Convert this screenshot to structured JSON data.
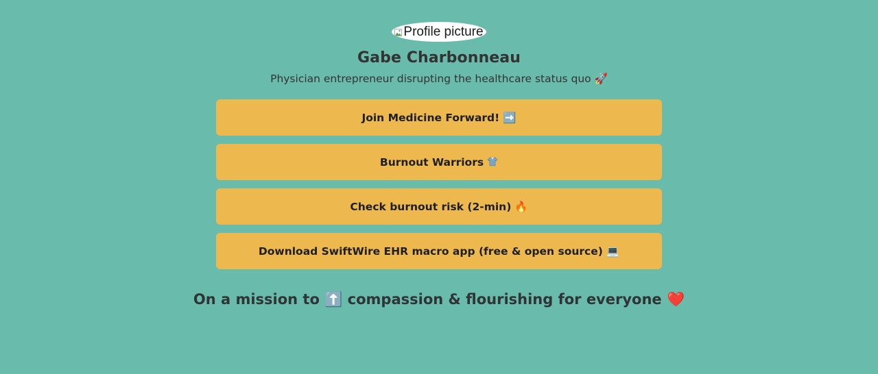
{
  "profile": {
    "avatar_alt": "Profile picture",
    "name": "Gabe Charbonneau",
    "bio": "Physician entrepreneur disrupting the healthcare status quo 🚀"
  },
  "links": [
    {
      "label": "Join Medicine Forward!",
      "emoji": "➡️",
      "icon": "right-arrow-icon"
    },
    {
      "label": "Burnout Warriors",
      "emoji": "🩻",
      "icon": "scrubs-icon"
    },
    {
      "label": "Check burnout risk (2-min)",
      "emoji": "🔥",
      "icon": "fire-icon"
    },
    {
      "label": "Download SwiftWire EHR macro app (free & open source)",
      "emoji": "💻",
      "icon": "laptop-icon"
    }
  ],
  "footer": {
    "mission_prefix": "On a mission to",
    "mission_emoji": "⬆️",
    "mission_suffix": "compassion & flourishing for everyone",
    "mission_end_emoji": "❤️"
  },
  "colors": {
    "background": "#69bbab",
    "button": "#edb94f",
    "text": "#333333"
  }
}
